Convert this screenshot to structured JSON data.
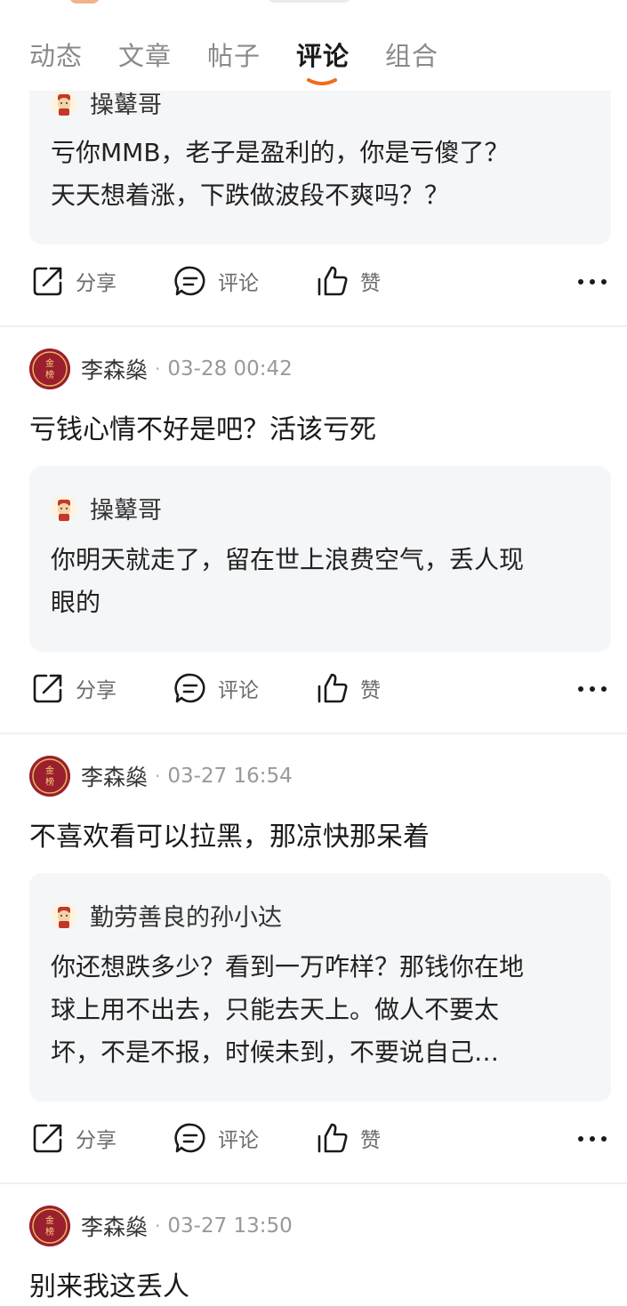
{
  "tabs": [
    {
      "label": "动态",
      "active": false
    },
    {
      "label": "文章",
      "active": false
    },
    {
      "label": "帖子",
      "active": false
    },
    {
      "label": "评论",
      "active": true
    },
    {
      "label": "组合",
      "active": false
    }
  ],
  "accent_color": "#f26b1d",
  "actions": {
    "share": "分享",
    "comment": "评论",
    "like": "赞"
  },
  "top_reply": {
    "user": "操鼙哥",
    "lines": [
      "亏你MMB，老子是盈利的，你是亏傻了？",
      "天天想着涨，下跌做波段不爽吗？？"
    ]
  },
  "posts": [
    {
      "author": "李森燊",
      "time": "03-28 00:42",
      "text": "亏钱心情不好是吧？活该亏死",
      "reply": {
        "user": "操鼙哥",
        "lines": [
          "你明天就走了，留在世上浪费空气，丢人现",
          "眼的"
        ]
      }
    },
    {
      "author": "李森燊",
      "time": "03-27 16:54",
      "text": "不喜欢看可以拉黑，那凉快那呆着",
      "reply": {
        "user": "勤劳善良的孙小达",
        "lines": [
          "你还想跌多少？看到一万咋样？那钱你在地",
          "球上用不出去，只能去天上。做人不要太",
          "坏，不是不报，时候未到，不要说自己…"
        ]
      }
    },
    {
      "author": "李森燊",
      "time": "03-27 13:50",
      "text": "别来我这丢人"
    }
  ]
}
